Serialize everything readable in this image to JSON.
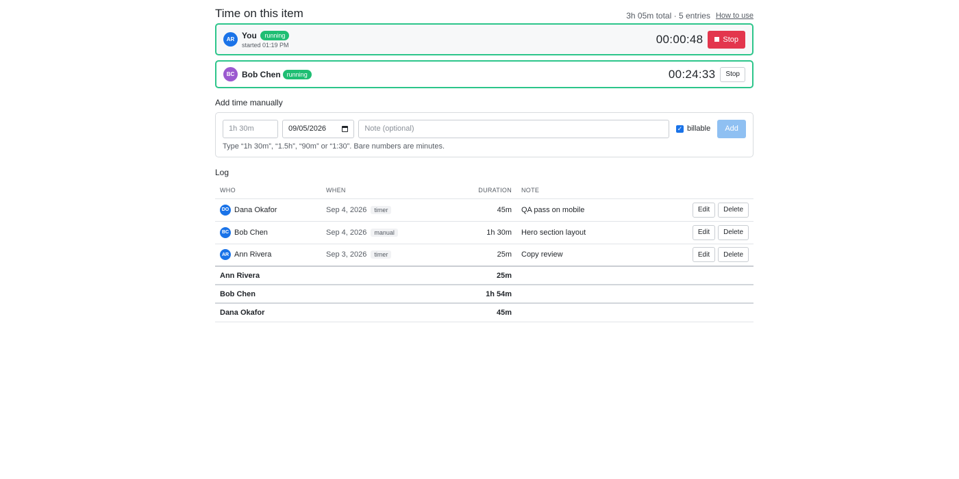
{
  "header": {
    "title": "Time on this item",
    "summary": "3h 05m total · 5 entries",
    "help_link": "How to use"
  },
  "running": [
    {
      "initials": "AR",
      "avatar_color": "#1a73e8",
      "name": "You",
      "status": "running",
      "started": "started 01:19 PM",
      "elapsed": "00:00:48",
      "stop_label": "Stop"
    },
    {
      "initials": "BC",
      "avatar_color": "#9b59d0",
      "name": "Bob Chen",
      "status": "running",
      "elapsed": "00:24:33",
      "stop_label": "Stop"
    }
  ],
  "manual": {
    "heading": "Add time manually",
    "duration_placeholder": "1h 30m",
    "date_value": "09/05/2026",
    "note_placeholder": "Note (optional)",
    "billable_label": "billable",
    "billable_checked": true,
    "add_label": "Add",
    "hint": "Type “1h 30m”, “1.5h”, “90m” or “1:30”. Bare numbers are minutes."
  },
  "log": {
    "heading": "Log",
    "columns": [
      "WHO",
      "WHEN",
      "DURATION",
      "NOTE"
    ],
    "rows": [
      {
        "initials": "DO",
        "avatar_color": "#1a73e8",
        "who": "Dana Okafor",
        "when": "Sep 4, 2026",
        "source": "timer",
        "duration": "45m",
        "note": "QA pass on mobile",
        "edit": "Edit",
        "delete": "Delete"
      },
      {
        "initials": "BC",
        "avatar_color": "#1a73e8",
        "who": "Bob Chen",
        "when": "Sep 4, 2026",
        "source": "manual",
        "duration": "1h 30m",
        "note": "Hero section layout",
        "edit": "Edit",
        "delete": "Delete"
      },
      {
        "initials": "AR",
        "avatar_color": "#1a73e8",
        "who": "Ann Rivera",
        "when": "Sep 3, 2026",
        "source": "timer",
        "duration": "25m",
        "note": "Copy review",
        "edit": "Edit",
        "delete": "Delete"
      }
    ],
    "totals": [
      {
        "who": "Ann Rivera",
        "duration": "25m"
      },
      {
        "who": "Bob Chen",
        "duration": "1h 54m"
      },
      {
        "who": "Dana Okafor",
        "duration": "45m"
      }
    ]
  }
}
